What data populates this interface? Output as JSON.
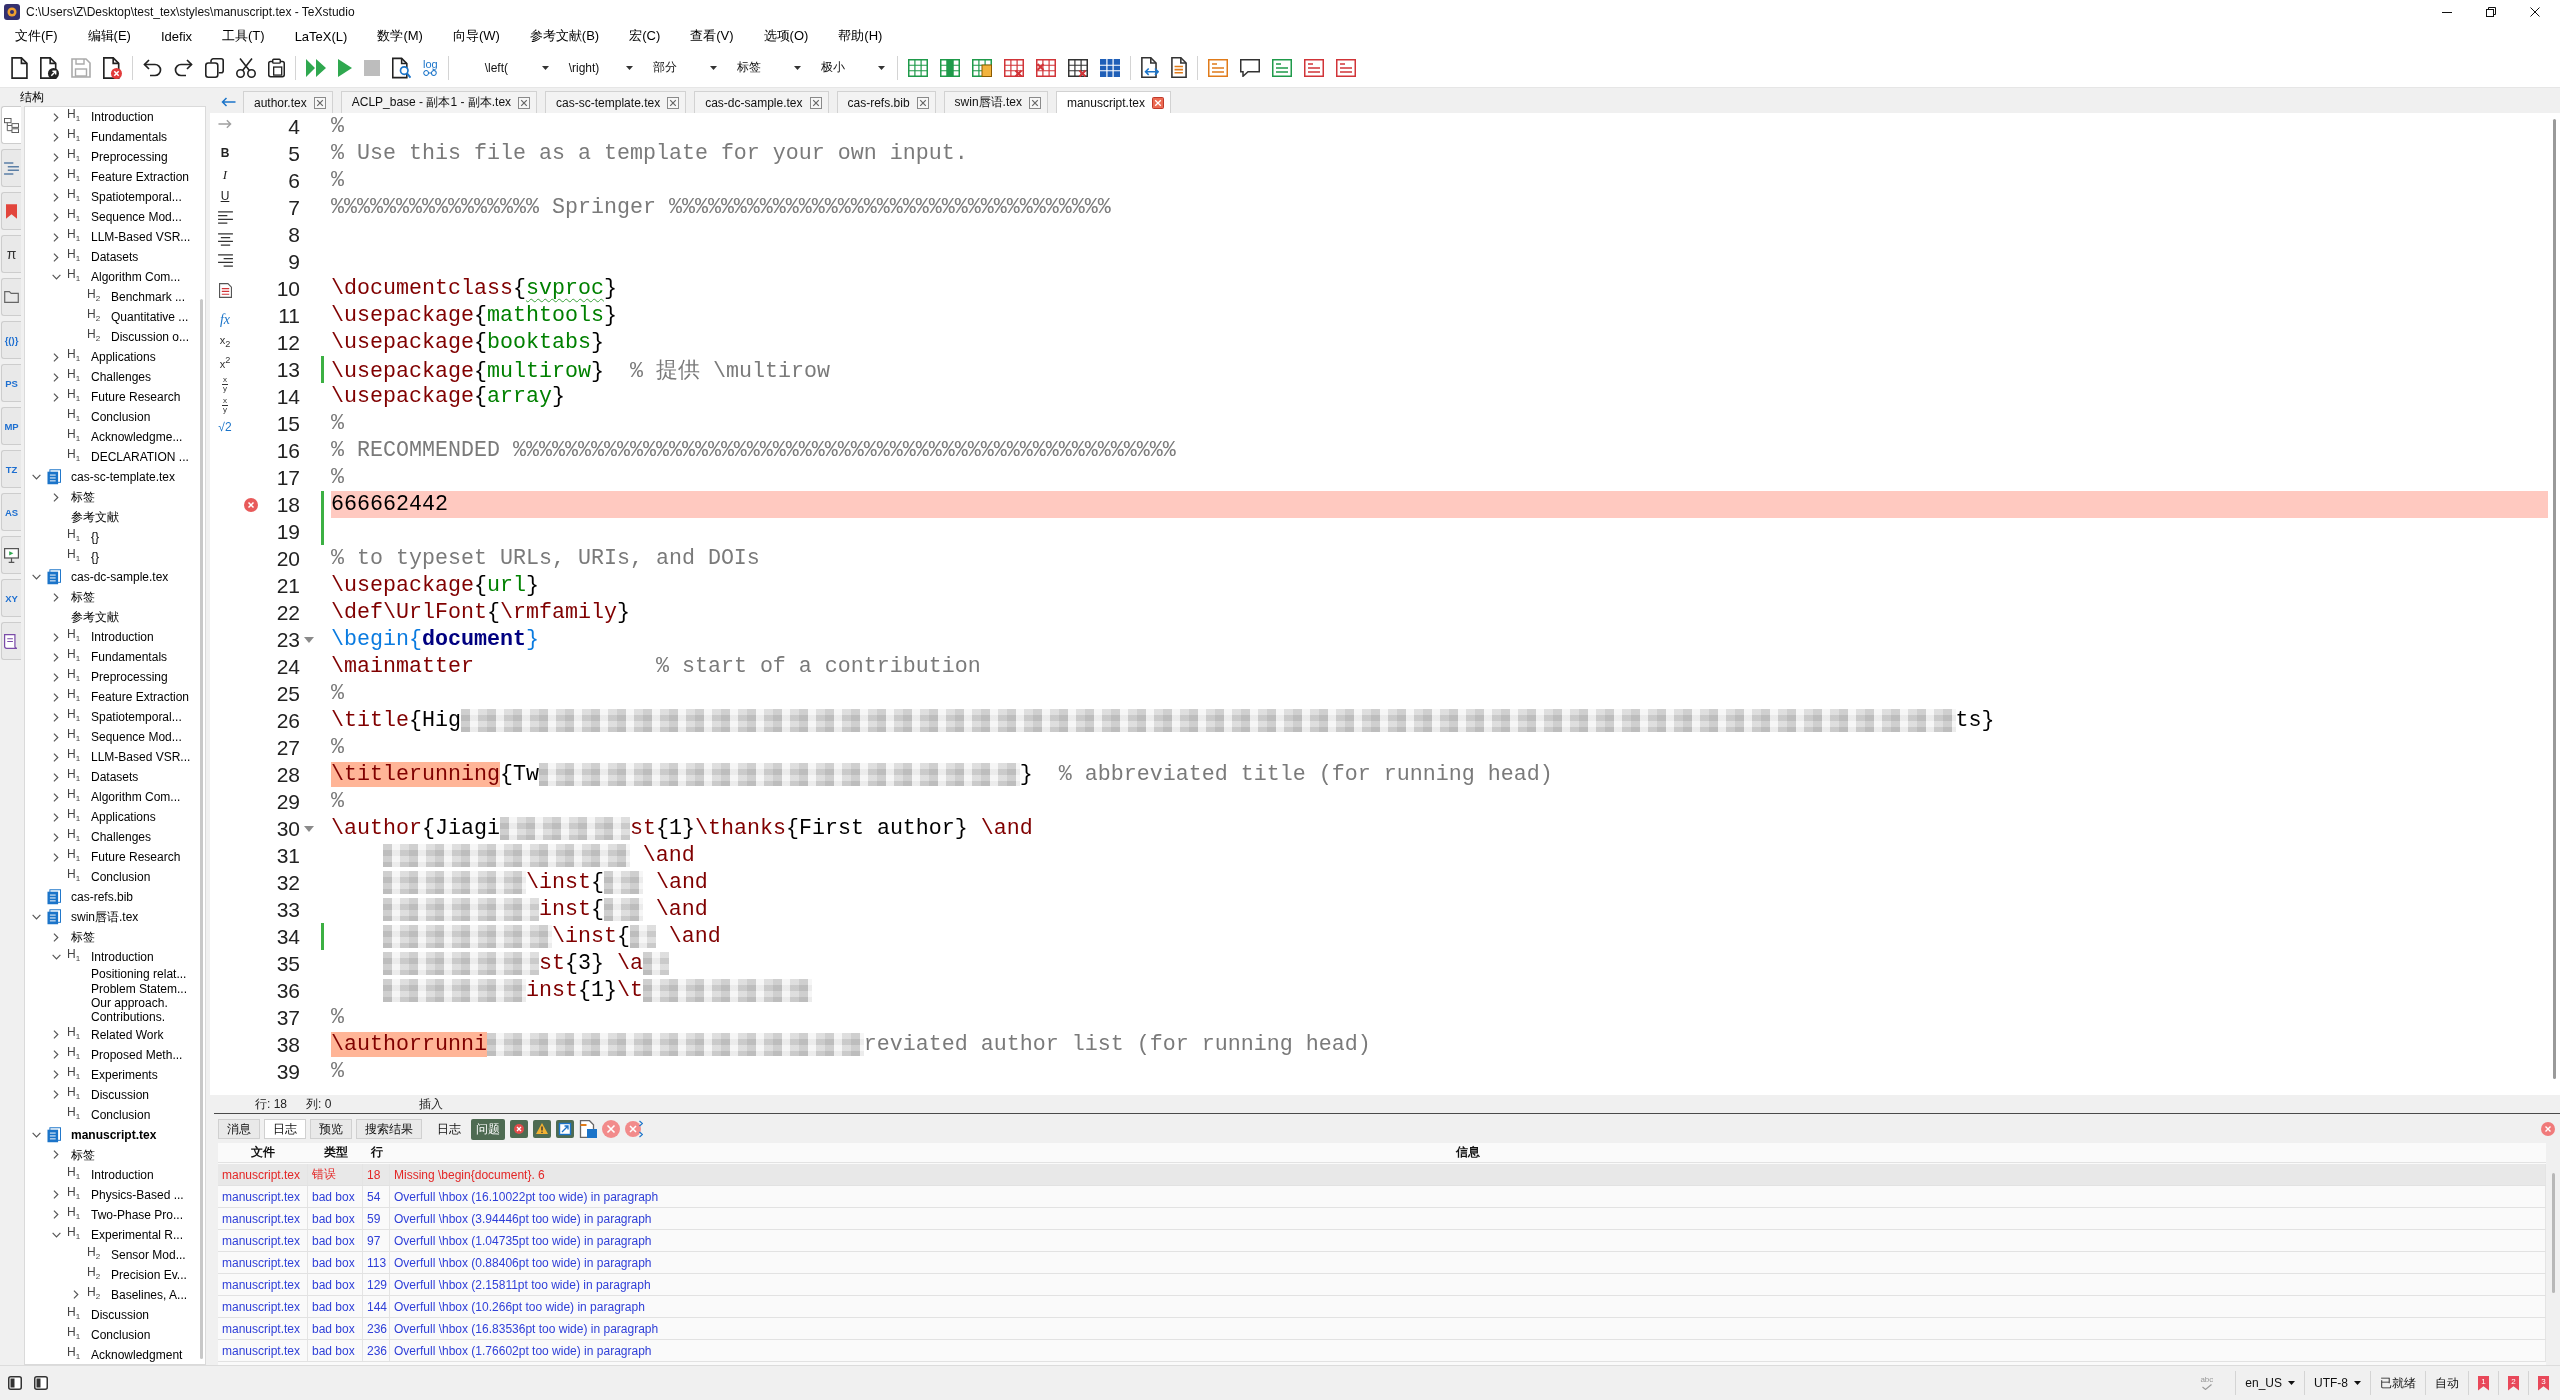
{
  "window": {
    "title": "C:\\Users\\Z\\Desktop\\test_tex\\styles\\manuscript.tex - TeXstudio"
  },
  "menu": [
    "文件(F)",
    "编辑(E)",
    "Idefix",
    "工具(T)",
    "LaTeX(L)",
    "数学(M)",
    "向导(W)",
    "参考文献(B)",
    "宏(C)",
    "查看(V)",
    "选项(O)",
    "帮助(H)"
  ],
  "toolbar": [
    [
      {
        "kind": "button",
        "disabled": false
      },
      {
        "kind": "button",
        "disabled": false
      },
      {
        "kind": "button",
        "disabled": true
      },
      {
        "kind": "button",
        "disabled": false
      }
    ],
    [
      {
        "kind": "button",
        "disabled": false
      },
      {
        "kind": "button",
        "disabled": false
      },
      {
        "kind": "button",
        "disabled": false
      },
      {
        "kind": "button",
        "disabled": false
      },
      {
        "kind": "button",
        "disabled": false
      }
    ],
    [
      {
        "kind": "button",
        "disabled": false
      },
      {
        "kind": "button",
        "disabled": false
      },
      {
        "kind": "button",
        "disabled": true
      },
      {
        "kind": "button",
        "disabled": false
      },
      {
        "kind": "labeled",
        "label": "log",
        "disabled": false
      }
    ],
    [
      {
        "kind": "combo",
        "value": "\\left("
      },
      {
        "kind": "combo",
        "value": "\\right)"
      },
      {
        "kind": "combo",
        "value": "部分"
      },
      {
        "kind": "combo",
        "value": "标签"
      },
      {
        "kind": "combo",
        "value": "极小"
      }
    ],
    [
      {
        "kind": "button",
        "disabled": false
      },
      {
        "kind": "button",
        "disabled": false
      },
      {
        "kind": "button",
        "disabled": false
      },
      {
        "kind": "button",
        "disabled": false
      },
      {
        "kind": "button",
        "disabled": false
      },
      {
        "kind": "button",
        "disabled": false
      },
      {
        "kind": "button",
        "disabled": false
      }
    ],
    [
      {
        "kind": "button",
        "disabled": false
      },
      {
        "kind": "button",
        "disabled": false
      }
    ],
    [
      {
        "kind": "button",
        "disabled": false
      },
      {
        "kind": "button",
        "disabled": false
      },
      {
        "kind": "button",
        "disabled": false
      },
      {
        "kind": "button",
        "disabled": false
      },
      {
        "kind": "button",
        "disabled": false
      }
    ]
  ],
  "structure": {
    "title": "结构",
    "sidebar_tabs": [
      {
        "kind": "icon",
        "selected": true
      },
      {
        "kind": "icon",
        "selected": false
      },
      {
        "kind": "icon",
        "selected": false
      },
      {
        "kind": "symbol",
        "label": "π",
        "selected": false
      },
      {
        "kind": "icon",
        "selected": false
      },
      {
        "kind": "text",
        "label": "{()}",
        "selected": false
      },
      {
        "kind": "text",
        "label": "PS",
        "selected": false
      },
      {
        "kind": "text",
        "label": "MP",
        "selected": false
      },
      {
        "kind": "text",
        "label": "TZ",
        "selected": false
      },
      {
        "kind": "text",
        "label": "AS",
        "selected": false
      },
      {
        "kind": "icon",
        "selected": false
      },
      {
        "kind": "text",
        "label": "XY",
        "selected": false
      },
      {
        "kind": "icon",
        "selected": false
      }
    ],
    "continued": [
      {
        "kind": "section",
        "mark": "H$_{1}$",
        "label": "Introduction",
        "has_children": true,
        "expanded": false
      },
      {
        "kind": "section",
        "mark": "H$_{1}$",
        "label": "Fundamentals",
        "has_children": true,
        "expanded": false
      },
      {
        "kind": "section",
        "mark": "H$_{1}$",
        "label": "Preprocessing",
        "has_children": true,
        "expanded": false
      },
      {
        "kind": "section",
        "mark": "H$_{1}$",
        "label": "Feature Extraction",
        "has_children": true,
        "expanded": false
      },
      {
        "kind": "section",
        "mark": "H$_{1}$",
        "label": "Spatiotemporal...",
        "has_children": true,
        "expanded": false
      },
      {
        "kind": "section",
        "mark": "H$_{1}$",
        "label": "Sequence Mod...",
        "has_children": true,
        "expanded": false
      },
      {
        "kind": "section",
        "mark": "H$_{1}$",
        "label": "LLM-Based VSR...",
        "has_children": true,
        "expanded": false
      },
      {
        "kind": "section",
        "mark": "H$_{1}$",
        "label": "Datasets",
        "has_children": true,
        "expanded": false
      },
      {
        "kind": "section",
        "mark": "H$_{1}$",
        "label": "Algorithm Com...",
        "has_children": true,
        "expanded": true,
        "children": [
          {
            "kind": "subsection",
            "mark": "H$_{2}$",
            "label": "Benchmark ...",
            "has_children": false,
            "expanded": false
          },
          {
            "kind": "subsection",
            "mark": "H$_{2}$",
            "label": "Quantitative ...",
            "has_children": false,
            "expanded": false
          },
          {
            "kind": "subsection",
            "mark": "H$_{2}$",
            "label": "Discussion o...",
            "has_children": false,
            "expanded": false
          }
        ]
      },
      {
        "kind": "section",
        "mark": "H$_{1}$",
        "label": "Applications",
        "has_children": true,
        "expanded": false
      },
      {
        "kind": "section",
        "mark": "H$_{1}$",
        "label": "Challenges",
        "has_children": true,
        "expanded": false
      },
      {
        "kind": "section",
        "mark": "H$_{1}$",
        "label": "Future Research",
        "has_children": true,
        "expanded": false
      },
      {
        "kind": "section",
        "mark": "H$_{1}$",
        "label": "Conclusion",
        "has_children": false,
        "expanded": false
      },
      {
        "kind": "section",
        "mark": "H$_{1}$",
        "label": "Acknowledgme...",
        "has_children": false,
        "expanded": false
      },
      {
        "kind": "section",
        "mark": "H$_{1}$",
        "label": "DECLARATION ...",
        "has_children": false,
        "expanded": false
      }
    ],
    "files": [
      {
        "kind": "file",
        "label": "cas-sc-template.tex",
        "current": false,
        "has_children": true,
        "expanded": true,
        "children": [
          {
            "kind": "group",
            "label": "标签",
            "has_children": true,
            "expanded": false
          },
          {
            "kind": "group",
            "label": "参考文献",
            "has_children": false,
            "expanded": false
          },
          {
            "kind": "section",
            "mark": "H$_{1}$",
            "label": "{}",
            "has_children": false,
            "expanded": false
          },
          {
            "kind": "section",
            "mark": "H$_{1}$",
            "label": "{}",
            "has_children": false,
            "expanded": false
          }
        ]
      },
      {
        "kind": "file",
        "label": "cas-dc-sample.tex",
        "current": false,
        "has_children": true,
        "expanded": true,
        "children": [
          {
            "kind": "group",
            "label": "标签",
            "has_children": true,
            "expanded": false
          },
          {
            "kind": "group",
            "label": "参考文献",
            "has_children": false,
            "expanded": false
          },
          {
            "kind": "section",
            "mark": "H$_{1}$",
            "label": "Introduction",
            "has_children": true,
            "expanded": false
          },
          {
            "kind": "section",
            "mark": "H$_{1}$",
            "label": "Fundamentals",
            "has_children": true,
            "expanded": false
          },
          {
            "kind": "section",
            "mark": "H$_{1}$",
            "label": "Preprocessing",
            "has_children": true,
            "expanded": false
          },
          {
            "kind": "section",
            "mark": "H$_{1}$",
            "label": "Feature Extraction",
            "has_children": true,
            "expanded": false
          },
          {
            "kind": "section",
            "mark": "H$_{1}$",
            "label": "Spatiotemporal...",
            "has_children": true,
            "expanded": false
          },
          {
            "kind": "section",
            "mark": "H$_{1}$",
            "label": "Sequence Mod...",
            "has_children": true,
            "expanded": false
          },
          {
            "kind": "section",
            "mark": "H$_{1}$",
            "label": "LLM-Based VSR...",
            "has_children": true,
            "expanded": false
          },
          {
            "kind": "section",
            "mark": "H$_{1}$",
            "label": "Datasets",
            "has_children": true,
            "expanded": false
          },
          {
            "kind": "section",
            "mark": "H$_{1}$",
            "label": "Algorithm Com...",
            "has_children": true,
            "expanded": false
          },
          {
            "kind": "section",
            "mark": "H$_{1}$",
            "label": "Applications",
            "has_children": true,
            "expanded": false
          },
          {
            "kind": "section",
            "mark": "H$_{1}$",
            "label": "Challenges",
            "has_children": true,
            "expanded": false
          },
          {
            "kind": "section",
            "mark": "H$_{1}$",
            "label": "Future Research",
            "has_children": true,
            "expanded": false
          },
          {
            "kind": "section",
            "mark": "H$_{1}$",
            "label": "Conclusion",
            "has_children": false,
            "expanded": false
          }
        ]
      },
      {
        "kind": "file",
        "label": "cas-refs.bib",
        "current": false,
        "has_children": false,
        "expanded": false
      },
      {
        "kind": "file",
        "label": "swin唇语.tex",
        "current": false,
        "has_children": true,
        "expanded": true,
        "children": [
          {
            "kind": "group",
            "label": "标签",
            "has_children": true,
            "expanded": false
          },
          {
            "kind": "section",
            "mark": "H$_{1}$",
            "label": "Introduction",
            "has_children": true,
            "expanded": true,
            "children": [
              {
                "kind": "paragraph",
                "label": "Positioning relat...",
                "has_children": false,
                "expanded": false
              },
              {
                "kind": "paragraph",
                "label": "Problem Statem...",
                "has_children": false,
                "expanded": false
              },
              {
                "kind": "paragraph",
                "label": "Our approach.",
                "has_children": false,
                "expanded": false
              },
              {
                "kind": "paragraph",
                "label": "Contributions.",
                "has_children": false,
                "expanded": false
              }
            ]
          },
          {
            "kind": "section",
            "mark": "H$_{1}$",
            "label": "Related Work",
            "has_children": true,
            "expanded": false
          },
          {
            "kind": "section",
            "mark": "H$_{1}$",
            "label": "Proposed Meth...",
            "has_children": true,
            "expanded": false
          },
          {
            "kind": "section",
            "mark": "H$_{1}$",
            "label": "Experiments",
            "has_children": true,
            "expanded": false
          },
          {
            "kind": "section",
            "mark": "H$_{1}$",
            "label": "Discussion",
            "has_children": true,
            "expanded": false
          },
          {
            "kind": "section",
            "mark": "H$_{1}$",
            "label": "Conclusion",
            "has_children": false,
            "expanded": false
          }
        ]
      },
      {
        "kind": "file",
        "label": "manuscript.tex",
        "current": true,
        "has_children": true,
        "expanded": true,
        "children": [
          {
            "kind": "group",
            "label": "标签",
            "has_children": true,
            "expanded": false
          },
          {
            "kind": "section",
            "mark": "H$_{1}$",
            "label": "Introduction",
            "has_children": false,
            "expanded": false
          },
          {
            "kind": "section",
            "mark": "H$_{1}$",
            "label": "Physics-Based ...",
            "has_children": true,
            "expanded": false
          },
          {
            "kind": "section",
            "mark": "H$_{1}$",
            "label": "Two-Phase Pro...",
            "has_children": true,
            "expanded": false
          },
          {
            "kind": "section",
            "mark": "H$_{1}$",
            "label": "Experimental R...",
            "has_children": true,
            "expanded": true,
            "children": [
              {
                "kind": "subsection",
                "mark": "H$_{2}$",
                "label": "Sensor Mod...",
                "has_children": false,
                "expanded": false
              },
              {
                "kind": "subsection",
                "mark": "H$_{2}$",
                "label": "Precision Ev...",
                "has_children": false,
                "expanded": false
              },
              {
                "kind": "subsection",
                "mark": "H$_{2}$",
                "label": "Baselines, A...",
                "has_children": true,
                "expanded": false
              }
            ]
          },
          {
            "kind": "section",
            "mark": "H$_{1}$",
            "label": "Discussion",
            "has_children": false,
            "expanded": false
          },
          {
            "kind": "section",
            "mark": "H$_{1}$",
            "label": "Conclusion",
            "has_children": false,
            "expanded": false
          },
          {
            "kind": "section",
            "mark": "H$_{1}$",
            "label": "Acknowledgment",
            "has_children": false,
            "expanded": false
          }
        ]
      }
    ]
  },
  "editor": {
    "navigation": [
      {
        "kind": "back",
        "disabled": false
      },
      {
        "kind": "forward",
        "disabled": true
      }
    ],
    "tabs": [
      {
        "label": "author.tex",
        "selected": false
      },
      {
        "label": "ACLP_base - 副本1 - 副本.tex",
        "selected": false
      },
      {
        "label": "cas-sc-template.tex",
        "selected": false
      },
      {
        "label": "cas-dc-sample.tex",
        "selected": false
      },
      {
        "label": "cas-refs.bib",
        "selected": false
      },
      {
        "label": "swin唇语.tex",
        "selected": false
      },
      {
        "label": "manuscript.tex",
        "selected": true
      }
    ],
    "format_tools": [
      {
        "kind": "bold",
        "label": "B"
      },
      {
        "kind": "italic",
        "label": "I"
      },
      {
        "kind": "underline",
        "label": "U"
      },
      {
        "kind": "align-left"
      },
      {
        "kind": "align-center"
      },
      {
        "kind": "align-right"
      },
      {
        "kind": "document"
      },
      {
        "kind": "function",
        "label": "fx"
      },
      {
        "kind": "script",
        "label": "x$_{2}$"
      },
      {
        "kind": "script",
        "label": "x$^{2}$"
      },
      {
        "kind": "fraction",
        "numerator": "x",
        "denominator": "y"
      },
      {
        "kind": "fraction",
        "numerator": "x",
        "denominator": "y"
      },
      {
        "kind": "root",
        "label": "√2"
      }
    ],
    "lines": [
      {
        "number": "4",
        "changed": false,
        "error": false,
        "foldable": false,
        "segments": [
          {
            "kind": "comment",
            "text": "%"
          }
        ]
      },
      {
        "number": "5",
        "changed": false,
        "error": false,
        "foldable": false,
        "segments": [
          {
            "kind": "comment",
            "text": "% Use this file as a template for your own input."
          }
        ]
      },
      {
        "number": "6",
        "changed": false,
        "error": false,
        "foldable": false,
        "segments": [
          {
            "kind": "comment",
            "text": "%"
          }
        ]
      },
      {
        "number": "7",
        "changed": false,
        "error": false,
        "foldable": false,
        "segments": [
          {
            "kind": "comment",
            "text": "%%%%%%%%%%%%%%%% Springer %%%%%%%%%%%%%%%%%%%%%%%%%%%%%%%%%%"
          }
        ]
      },
      {
        "number": "8",
        "changed": false,
        "error": false,
        "foldable": false
      },
      {
        "number": "9",
        "changed": false,
        "error": false,
        "foldable": false
      },
      {
        "number": "10",
        "changed": false,
        "error": false,
        "foldable": false,
        "segments": [
          {
            "kind": "command",
            "text": "\\documentclass"
          },
          {
            "kind": "brace",
            "text": "{"
          },
          {
            "kind": "flagged-arg",
            "text": "svproc"
          },
          {
            "kind": "brace",
            "text": "}"
          }
        ]
      },
      {
        "number": "11",
        "changed": false,
        "error": false,
        "foldable": false,
        "segments": [
          {
            "kind": "command",
            "text": "\\usepackage"
          },
          {
            "kind": "brace",
            "text": "{"
          },
          {
            "kind": "arg",
            "text": "mathtools"
          },
          {
            "kind": "brace",
            "text": "}"
          }
        ]
      },
      {
        "number": "12",
        "changed": false,
        "error": false,
        "foldable": false,
        "segments": [
          {
            "kind": "command",
            "text": "\\usepackage"
          },
          {
            "kind": "brace",
            "text": "{"
          },
          {
            "kind": "arg",
            "text": "booktabs"
          },
          {
            "kind": "brace",
            "text": "}"
          }
        ]
      },
      {
        "number": "13",
        "changed": true,
        "error": false,
        "foldable": false,
        "segments": [
          {
            "kind": "command",
            "text": "\\usepackage"
          },
          {
            "kind": "brace",
            "text": "{"
          },
          {
            "kind": "arg",
            "text": "multirow"
          },
          {
            "kind": "brace",
            "text": "}"
          },
          {
            "kind": "comment",
            "text": "  % 提供 \\multirow"
          }
        ]
      },
      {
        "number": "14",
        "changed": false,
        "error": false,
        "foldable": false,
        "segments": [
          {
            "kind": "command",
            "text": "\\usepackage"
          },
          {
            "kind": "brace",
            "text": "{"
          },
          {
            "kind": "arg",
            "text": "array"
          },
          {
            "kind": "brace",
            "text": "}"
          }
        ]
      },
      {
        "number": "15",
        "changed": false,
        "error": false,
        "foldable": false,
        "segments": [
          {
            "kind": "comment",
            "text": "%"
          }
        ]
      },
      {
        "number": "16",
        "changed": false,
        "error": false,
        "foldable": false,
        "segments": [
          {
            "kind": "comment",
            "text": "% RECOMMENDED %%%%%%%%%%%%%%%%%%%%%%%%%%%%%%%%%%%%%%%%%%%%%%%%%%%"
          }
        ]
      },
      {
        "number": "17",
        "changed": false,
        "error": false,
        "foldable": false,
        "segments": [
          {
            "kind": "comment",
            "text": "%"
          }
        ]
      },
      {
        "number": "18",
        "changed": true,
        "error": true,
        "foldable": false,
        "segments": [
          {
            "kind": "plain",
            "text": "666662442"
          }
        ]
      },
      {
        "number": "19",
        "changed": true,
        "error": false,
        "foldable": false
      },
      {
        "number": "20",
        "changed": false,
        "error": false,
        "foldable": false,
        "segments": [
          {
            "kind": "comment",
            "text": "% to typeset URLs, URIs, and DOIs"
          }
        ]
      },
      {
        "number": "21",
        "changed": false,
        "error": false,
        "foldable": false,
        "segments": [
          {
            "kind": "command",
            "text": "\\usepackage"
          },
          {
            "kind": "brace",
            "text": "{"
          },
          {
            "kind": "arg",
            "text": "url"
          },
          {
            "kind": "brace",
            "text": "}"
          }
        ]
      },
      {
        "number": "22",
        "changed": false,
        "error": false,
        "foldable": false,
        "segments": [
          {
            "kind": "command",
            "text": "\\def\\UrlFont"
          },
          {
            "kind": "brace",
            "text": "{"
          },
          {
            "kind": "command",
            "text": "\\rmfamily"
          },
          {
            "kind": "brace",
            "text": "}"
          }
        ]
      },
      {
        "number": "23",
        "changed": false,
        "error": false,
        "foldable": true,
        "segments": [
          {
            "kind": "keyword",
            "text": "\\begin{"
          },
          {
            "kind": "env",
            "text": "document"
          },
          {
            "kind": "keyword",
            "text": "}"
          }
        ]
      },
      {
        "number": "24",
        "changed": false,
        "error": false,
        "foldable": false,
        "segments": [
          {
            "kind": "command",
            "text": "\\mainmatter"
          },
          {
            "kind": "comment",
            "text": "              % start of a contribution"
          }
        ]
      },
      {
        "number": "25",
        "changed": false,
        "error": false,
        "foldable": false,
        "segments": [
          {
            "kind": "comment",
            "text": "%"
          }
        ]
      },
      {
        "number": "26",
        "changed": false,
        "error": false,
        "foldable": false,
        "segments": [
          {
            "kind": "command",
            "text": "\\title"
          },
          {
            "kind": "brace",
            "text": "{"
          },
          {
            "kind": "plain",
            "text": "Hig"
          },
          {
            "kind": "redacted"
          },
          {
            "kind": "plain",
            "text": "ts"
          },
          {
            "kind": "brace",
            "text": "}"
          }
        ]
      },
      {
        "number": "27",
        "changed": false,
        "error": false,
        "foldable": false,
        "segments": [
          {
            "kind": "comment",
            "text": "%"
          }
        ]
      },
      {
        "number": "28",
        "changed": false,
        "error": false,
        "foldable": false,
        "segments": [
          {
            "kind": "flagged-command",
            "text": "\\titlerunning"
          },
          {
            "kind": "brace",
            "text": "{"
          },
          {
            "kind": "plain",
            "text": "Tw"
          },
          {
            "kind": "redacted"
          },
          {
            "kind": "brace",
            "text": "}"
          },
          {
            "kind": "comment",
            "text": "  % abbreviated title (for running head)"
          }
        ]
      },
      {
        "number": "29",
        "changed": false,
        "error": false,
        "foldable": false,
        "segments": [
          {
            "kind": "comment",
            "text": "%"
          }
        ]
      },
      {
        "number": "30",
        "changed": false,
        "error": false,
        "foldable": true,
        "segments": [
          {
            "kind": "command",
            "text": "\\author"
          },
          {
            "kind": "brace",
            "text": "{"
          },
          {
            "kind": "plain",
            "text": "Jiagi"
          },
          {
            "kind": "redacted"
          },
          {
            "kind": "command",
            "text": "st"
          },
          {
            "kind": "brace",
            "text": "{"
          },
          {
            "kind": "plain",
            "text": "1"
          },
          {
            "kind": "brace",
            "text": "}"
          },
          {
            "kind": "command",
            "text": "\\thanks"
          },
          {
            "kind": "brace",
            "text": "{"
          },
          {
            "kind": "plain",
            "text": "First author"
          },
          {
            "kind": "brace",
            "text": "} "
          },
          {
            "kind": "command",
            "text": "\\and"
          }
        ]
      },
      {
        "number": "31",
        "changed": false,
        "error": false,
        "foldable": false,
        "segments": [
          {
            "kind": "redacted"
          },
          {
            "kind": "command",
            "text": " \\and"
          }
        ]
      },
      {
        "number": "32",
        "changed": false,
        "error": false,
        "foldable": false,
        "segments": [
          {
            "kind": "redacted"
          },
          {
            "kind": "command",
            "text": "\\inst"
          },
          {
            "kind": "brace",
            "text": "{"
          },
          {
            "kind": "redacted"
          },
          {
            "kind": "command",
            "text": " \\and"
          }
        ]
      },
      {
        "number": "33",
        "changed": false,
        "error": false,
        "foldable": false,
        "segments": [
          {
            "kind": "redacted"
          },
          {
            "kind": "command",
            "text": "inst"
          },
          {
            "kind": "brace",
            "text": "{"
          },
          {
            "kind": "redacted"
          },
          {
            "kind": "command",
            "text": " \\and"
          }
        ]
      },
      {
        "number": "34",
        "changed": true,
        "error": false,
        "foldable": false,
        "segments": [
          {
            "kind": "redacted"
          },
          {
            "kind": "command",
            "text": "\\inst"
          },
          {
            "kind": "brace",
            "text": "{"
          },
          {
            "kind": "redacted"
          },
          {
            "kind": "command",
            "text": " \\and"
          }
        ]
      },
      {
        "number": "35",
        "changed": false,
        "error": false,
        "foldable": false,
        "segments": [
          {
            "kind": "redacted"
          },
          {
            "kind": "command",
            "text": "st"
          },
          {
            "kind": "brace",
            "text": "{"
          },
          {
            "kind": "plain",
            "text": "3"
          },
          {
            "kind": "brace",
            "text": "}"
          },
          {
            "kind": "command",
            "text": " \\a"
          },
          {
            "kind": "redacted"
          }
        ]
      },
      {
        "number": "36",
        "changed": false,
        "error": false,
        "foldable": false,
        "segments": [
          {
            "kind": "redacted"
          },
          {
            "kind": "command",
            "text": "inst"
          },
          {
            "kind": "brace",
            "text": "{"
          },
          {
            "kind": "plain",
            "text": "1"
          },
          {
            "kind": "brace",
            "text": "}"
          },
          {
            "kind": "command",
            "text": "\\t"
          },
          {
            "kind": "redacted"
          }
        ]
      },
      {
        "number": "37",
        "changed": false,
        "error": false,
        "foldable": false,
        "segments": [
          {
            "kind": "comment",
            "text": "%"
          }
        ]
      },
      {
        "number": "38",
        "changed": false,
        "error": false,
        "foldable": false,
        "segments": [
          {
            "kind": "flagged-command",
            "text": "\\authorrunni"
          },
          {
            "kind": "redacted"
          },
          {
            "kind": "comment",
            "text": "reviated author list (for running head)"
          }
        ]
      },
      {
        "number": "39",
        "changed": false,
        "error": false,
        "foldable": false,
        "segments": [
          {
            "kind": "comment",
            "text": "%"
          }
        ]
      }
    ]
  },
  "position": {
    "line": "行: 18",
    "column": "列: 0",
    "mode": "插入"
  },
  "messages": {
    "tabs": [
      {
        "label": "消息",
        "selected": false
      },
      {
        "label": "日志",
        "selected": true
      },
      {
        "label": "预览",
        "selected": false
      },
      {
        "label": "搜索结果",
        "selected": false
      }
    ],
    "log_tools": [
      {
        "kind": "text",
        "label": "日志",
        "on": false
      },
      {
        "kind": "text",
        "label": "问题",
        "on": true
      },
      {
        "kind": "errors",
        "on": true
      },
      {
        "kind": "warnings",
        "on": true
      },
      {
        "kind": "bad-boxes",
        "on": true
      },
      {
        "kind": "document",
        "on": false
      },
      {
        "kind": "clear",
        "on": false
      },
      {
        "kind": "clear-all",
        "on": false
      }
    ],
    "table": {
      "columns": [
        "文件",
        "类型",
        "行",
        "信息"
      ],
      "rows": [
        {
          "kind": "error",
          "selected": true,
          "file": "manuscript.tex",
          "type": "错误",
          "line": "18",
          "message": "Missing \\begin{document}. 6"
        },
        {
          "kind": "bad-box",
          "selected": false,
          "file": "manuscript.tex",
          "type": "bad box",
          "line": "54",
          "message": "Overfull \\hbox (16.10022pt too wide) in paragraph"
        },
        {
          "kind": "bad-box",
          "selected": false,
          "file": "manuscript.tex",
          "type": "bad box",
          "line": "59",
          "message": "Overfull \\hbox (3.94446pt too wide) in paragraph"
        },
        {
          "kind": "bad-box",
          "selected": false,
          "file": "manuscript.tex",
          "type": "bad box",
          "line": "97",
          "message": "Overfull \\hbox (1.04735pt too wide) in paragraph"
        },
        {
          "kind": "bad-box",
          "selected": false,
          "file": "manuscript.tex",
          "type": "bad box",
          "line": "113",
          "message": "Overfull \\hbox (0.88406pt too wide) in paragraph"
        },
        {
          "kind": "bad-box",
          "selected": false,
          "file": "manuscript.tex",
          "type": "bad box",
          "line": "129",
          "message": "Overfull \\hbox (2.15811pt too wide) in paragraph"
        },
        {
          "kind": "bad-box",
          "selected": false,
          "file": "manuscript.tex",
          "type": "bad box",
          "line": "144",
          "message": "Overfull \\hbox (10.266pt too wide) in paragraph"
        },
        {
          "kind": "bad-box",
          "selected": false,
          "file": "manuscript.tex",
          "type": "bad box",
          "line": "236",
          "message": "Overfull \\hbox (16.83536pt too wide) in paragraph"
        },
        {
          "kind": "bad-box",
          "selected": false,
          "file": "manuscript.tex",
          "type": "bad box",
          "line": "236",
          "message": "Overfull \\hbox (1.76602pt too wide) in paragraph"
        }
      ]
    }
  },
  "status_bar": {
    "spelling": "abc",
    "language": "en_US",
    "encoding": "UTF-8",
    "status": "已就绪",
    "mode": "自动",
    "bookmarks": [
      "1",
      "2",
      "3"
    ]
  }
}
